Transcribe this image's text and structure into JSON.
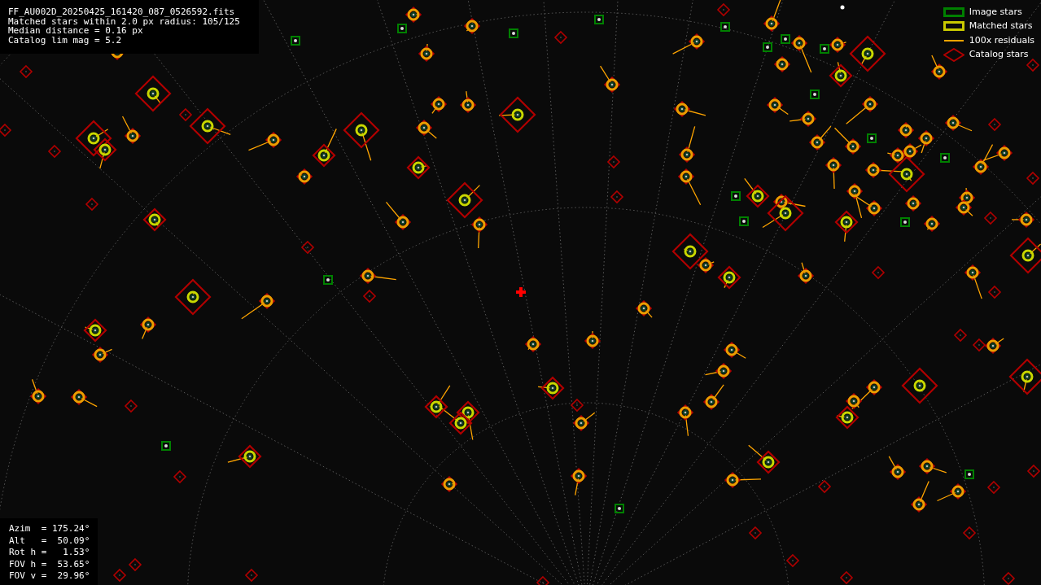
{
  "info_lines": [
    "FF_AU002D_20250425_161420_087_0526592.fits",
    "Matched stars within 2.0 px radius: 105/125",
    "Median distance = 0.16 px",
    "Catalog lim mag = 5.2"
  ],
  "legend": [
    {
      "kind": "image",
      "label": "Image stars",
      "color": "#008000"
    },
    {
      "kind": "matched",
      "label": "Matched stars",
      "color": "#c8c800"
    },
    {
      "kind": "residual",
      "label": "100x residuals",
      "color": "#ffa500"
    },
    {
      "kind": "catalog",
      "label": "Catalog stars",
      "color": "#b00000"
    }
  ],
  "pointing": [
    "Azim  = 175.24°",
    "Alt   =  50.09°",
    "Rot h =   1.53°",
    "FOV h =  53.65°",
    "FOV v =  29.96°"
  ]
}
